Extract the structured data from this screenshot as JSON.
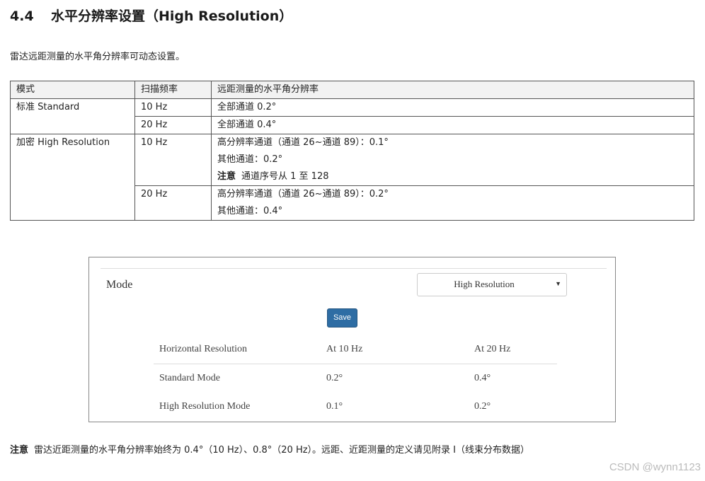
{
  "section": {
    "number": "4.4",
    "title": "水平分辨率设置（High Resolution）"
  },
  "intro": "雷达远距测量的水平角分辨率可动态设置。",
  "spec_table": {
    "headers": [
      "模式",
      "扫描频率",
      "远距测量的水平角分辨率"
    ],
    "standard": {
      "mode": "标准  Standard",
      "rows": [
        {
          "freq": "10 Hz",
          "res": "全部通道 0.2°"
        },
        {
          "freq": "20 Hz",
          "res": "全部通道 0.4°"
        }
      ]
    },
    "high": {
      "mode": "加密  High Resolution",
      "rows": [
        {
          "freq": "10 Hz",
          "lines": [
            "高分辨率通道（通道 26~通道 89）：0.1°",
            "其他通道：0.2°"
          ],
          "note_label": "注意",
          "note_text": "通道序号从 1 至 128"
        },
        {
          "freq": "20 Hz",
          "lines": [
            "高分辨率通道（通道 26~通道 89）：0.2°",
            "其他通道：0.4°"
          ]
        }
      ]
    }
  },
  "ui": {
    "mode_label": "Mode",
    "select_value": "High Resolution",
    "save_label": "Save",
    "table": {
      "headers": [
        "Horizontal Resolution",
        "At 10 Hz",
        "At 20 Hz"
      ],
      "rows": [
        [
          "Standard Mode",
          "0.2°",
          "0.4°"
        ],
        [
          "High Resolution Mode",
          "0.1°",
          "0.2°"
        ]
      ]
    }
  },
  "footnote": {
    "label": "注意",
    "text": "雷达近距测量的水平角分辨率始终为 0.4°（10 Hz）、0.8°（20 Hz）。远距、近距测量的定义请见附录 I（线束分布数据）"
  },
  "watermark": "CSDN @wynn1123"
}
